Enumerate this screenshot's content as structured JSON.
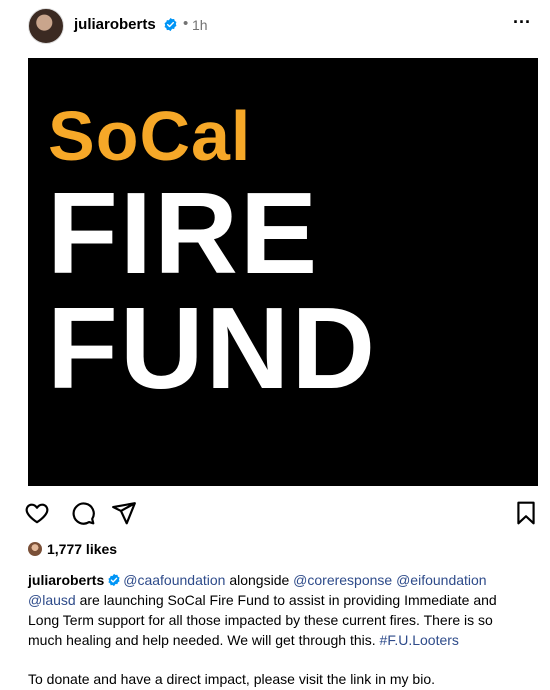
{
  "header": {
    "username": "juliaroberts",
    "separator": "•",
    "time": "1h",
    "more_label": "..."
  },
  "image": {
    "line1": "SoCal",
    "line2": "FIRE",
    "line3": "FUND",
    "background": "#000000",
    "accent": "#f6a828"
  },
  "actions": {
    "like": "heart-icon",
    "comment": "comment-icon",
    "share": "share-icon",
    "save": "bookmark-icon"
  },
  "likes": {
    "text": "1,777 likes"
  },
  "caption": {
    "username": "juliaroberts",
    "mention1": "@caafoundation",
    "text1": " alongside ",
    "mention2": "@coreresponse",
    "space": " ",
    "mention3": "@eifoundation",
    "mention4": "@lausd",
    "text2": " are launching SoCal Fire Fund to assist in providing Immediate and Long Term support for all those impacted by these current fires. There is so much healing and help needed. We will get through this. ",
    "hashtag": "#F.U.Looters",
    "donate": "To donate and have a direct impact, please visit the link in my bio."
  },
  "colors": {
    "verified": "#0095f6",
    "link": "#2e4b8a",
    "meta": "#737373"
  }
}
